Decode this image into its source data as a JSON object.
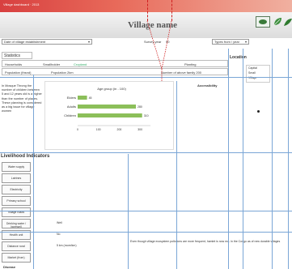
{
  "topbar": {
    "text": "Village dashboard · 2013"
  },
  "header": {
    "title": "Village name"
  },
  "filters": {
    "village_dropdown": "Date of village establishment",
    "year_label": "Survey year",
    "year_value": "90",
    "source_dropdown": "Types from / year"
  },
  "tabs": {
    "label": "Statistics"
  },
  "form": {
    "row1_label": "Households",
    "row1_value": "Smallholder",
    "row1_sub": "Cropland",
    "row1_right": "Planting",
    "row2_label": "Population (thsnd)",
    "row2_value": "Population 2km",
    "row2_right": "Number of above family 200"
  },
  "intro": {
    "text": "In Mosque Throng the number of children between 5 and 12 years old is a higher than the number of places. These planning is considered as a big issue for village women"
  },
  "chart_data": {
    "type": "bar",
    "title": "Age group (in - 100)",
    "categories": [
      "Elders",
      "Adults",
      "Children"
    ],
    "values": [
      45,
      280,
      310
    ],
    "xlim": [
      0,
      350
    ],
    "xticks": [
      "0",
      "100",
      "200",
      "300"
    ]
  },
  "accessibility": {
    "label": "Accessibility"
  },
  "location": {
    "title": "Location",
    "legend": [
      "Capital",
      "Small",
      "Village"
    ]
  },
  "indicators": {
    "title": "Livelihood Indicators",
    "rows": [
      {
        "label": "Water supply",
        "value": ""
      },
      {
        "label": "Latrines",
        "value": ""
      },
      {
        "label": "Electricity",
        "value": ""
      },
      {
        "label": "Primary school",
        "value": ""
      },
      {
        "label": "Village roads",
        "value": ""
      },
      {
        "label": "Drinking water / borewell",
        "value": "Well"
      },
      {
        "label": "Health unit",
        "value": "No"
      },
      {
        "label": "Distance rural",
        "value": "5 km (more/km)"
      },
      {
        "label": "Market (from)",
        "value": ""
      }
    ],
    "footer": "Disease"
  },
  "bottom_note": {
    "text": "Even though village ecosystem pollutions are more frequent, hamlet is now mo- in the Congo as of new durable villages"
  },
  "colors": {
    "topbar": "#d84040",
    "bar": "#8cbf5a",
    "guide": "#7aa6d6",
    "dash": "#d02020"
  }
}
